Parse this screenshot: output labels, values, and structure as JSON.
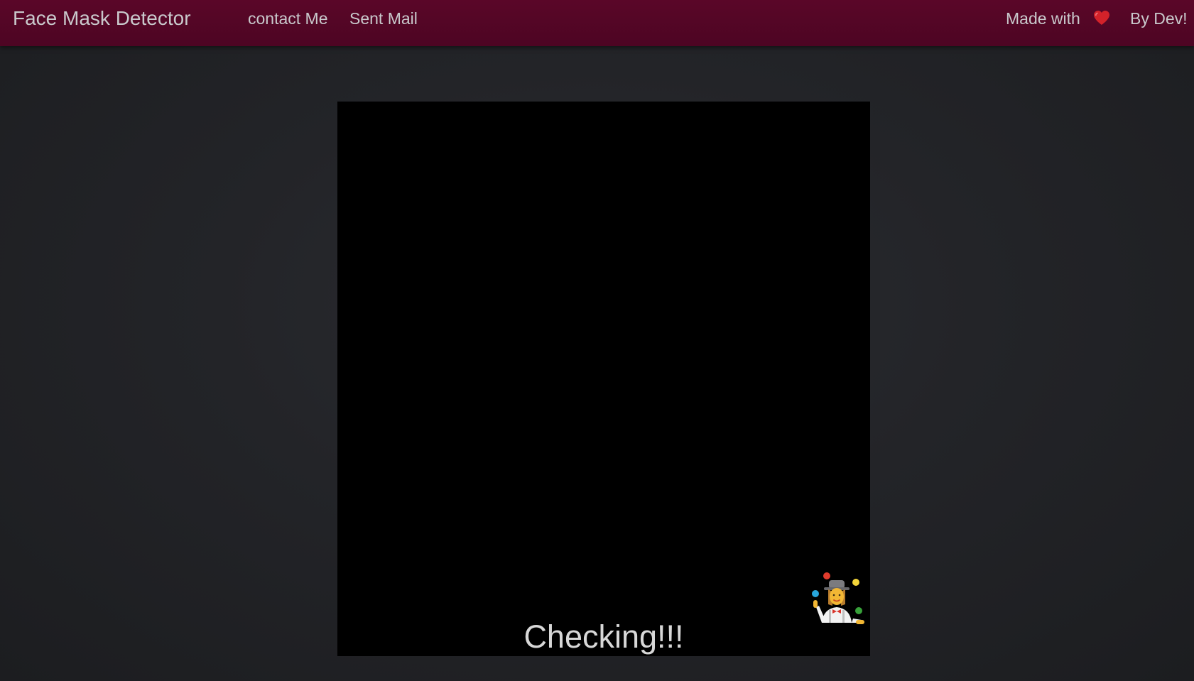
{
  "navbar": {
    "brand": "Face Mask Detector",
    "links": [
      "contact Me",
      "Sent Mail"
    ],
    "made_with": "Made with",
    "heart_icon": "heart-icon",
    "by_dev": "By Dev!",
    "background_color": "#570626"
  },
  "main": {
    "status_text": "Checking!!!",
    "overlay_icon": "woman-juggling-icon",
    "video_background": "#000000"
  }
}
